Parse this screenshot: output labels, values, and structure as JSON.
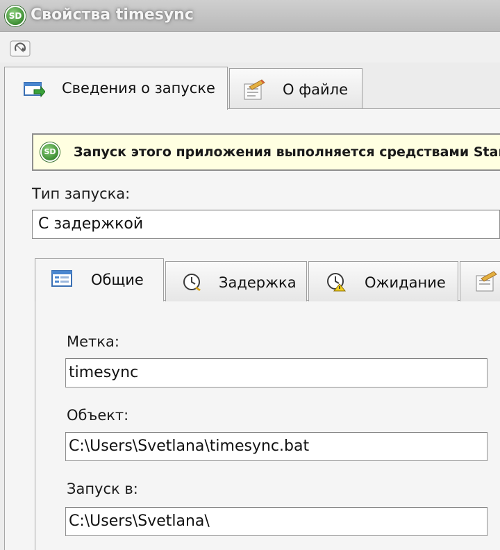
{
  "window": {
    "app_icon": "SD",
    "title": "Свойства timesync"
  },
  "toolbar": {
    "icon": "refresh-icon"
  },
  "outer_tabs": [
    {
      "label": "Сведения о запуске",
      "icon": "launch-info-icon",
      "active": true
    },
    {
      "label": "О файле",
      "icon": "file-info-icon",
      "active": false
    }
  ],
  "banner": {
    "icon": "SD",
    "text": "Запуск этого приложения выполняется средствами Start"
  },
  "launch_type": {
    "label": "Тип запуска:",
    "value": "С задержкой"
  },
  "inner_tabs": [
    {
      "label": "Общие",
      "icon": "general-icon",
      "active": true
    },
    {
      "label": "Задержка",
      "icon": "clock-icon",
      "active": false
    },
    {
      "label": "Ожидание",
      "icon": "wait-clock-icon",
      "active": false
    },
    {
      "label": "",
      "icon": "more-icon",
      "active": false
    }
  ],
  "fields": {
    "label": {
      "label": "Метка:",
      "value": "timesync"
    },
    "object": {
      "label": "Объект:",
      "value": "C:\\Users\\Svetlana\\timesync.bat"
    },
    "start_in": {
      "label": "Запуск в:",
      "value": "C:\\Users\\Svetlana\\"
    }
  },
  "colors": {
    "banner_bg": "#ffffe1",
    "sd_green": "#3f8f35"
  }
}
